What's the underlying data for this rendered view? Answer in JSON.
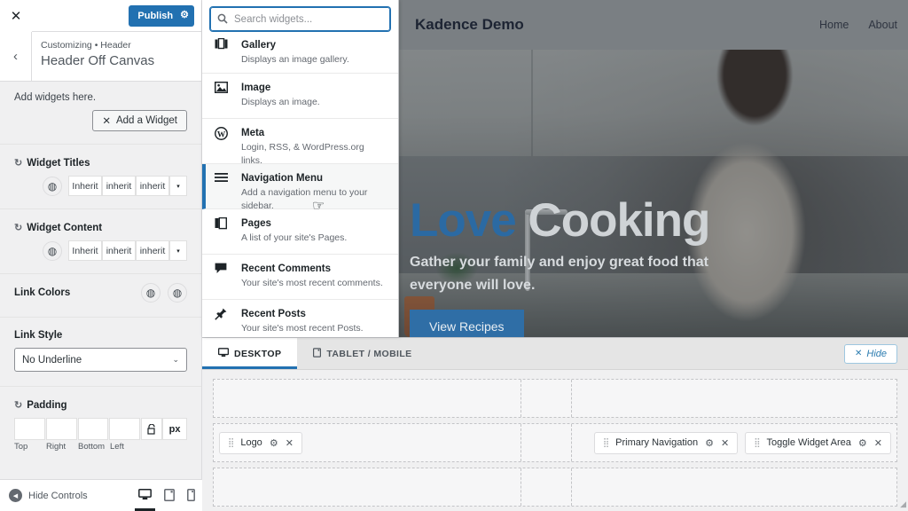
{
  "sidebar": {
    "close_icon": "✕",
    "publish_label": "Publish",
    "publish_gear_icon": "⚙",
    "back_icon": "‹",
    "breadcrumb": "Customizing • Header",
    "panel_title": "Header Off Canvas",
    "add_widgets_text": "Add widgets here.",
    "add_widget_label": "Add a Widget",
    "add_widget_icon": "✕",
    "controls": [
      {
        "label": "Widget Titles",
        "reset_icon": "↺",
        "globe_icon": "◍",
        "values": [
          "Inherit",
          "inherit",
          "inherit"
        ],
        "caret_icon": "▾"
      },
      {
        "label": "Widget Content",
        "reset_icon": "↺",
        "globe_icon": "◍",
        "values": [
          "Inherit",
          "inherit",
          "inherit"
        ],
        "caret_icon": "▾"
      }
    ],
    "link_colors": {
      "label": "Link Colors",
      "icons": [
        "◍",
        "◍"
      ]
    },
    "link_style": {
      "label": "Link Style",
      "value": "No Underline",
      "chevron_icon": "⌄"
    },
    "padding": {
      "label": "Padding",
      "reset_icon": "↺",
      "values": [
        "",
        "",
        "",
        ""
      ],
      "sub_labels": [
        "Top",
        "Right",
        "Bottom",
        "Left"
      ],
      "lock_icon": "⌂",
      "unit": "px"
    },
    "footer": {
      "hide_controls_label": "Hide Controls",
      "hide_controls_icon": "◀",
      "devices": [
        {
          "name": "desktop",
          "icon": "🖵",
          "active": true
        },
        {
          "name": "tablet",
          "icon": "▯",
          "active": false
        },
        {
          "name": "mobile",
          "icon": "▯",
          "active": false
        }
      ]
    }
  },
  "picker": {
    "search_placeholder": "Search widgets...",
    "search_value": "",
    "search_icon": "⌕",
    "widgets": [
      {
        "icon": "▣",
        "title": "Gallery",
        "desc": "Displays an image gallery.",
        "highlight": false
      },
      {
        "icon": "▨",
        "title": "Image",
        "desc": "Displays an image.",
        "highlight": false
      },
      {
        "icon": "Ⓦ",
        "title": "Meta",
        "desc": "Login, RSS, & WordPress.org links.",
        "highlight": false
      },
      {
        "icon": "☰",
        "title": "Navigation Menu",
        "desc": "Add a navigation menu to your sidebar.",
        "highlight": true
      },
      {
        "icon": "❑",
        "title": "Pages",
        "desc": "A list of your site's Pages.",
        "highlight": false
      },
      {
        "icon": "🗩",
        "title": "Recent Comments",
        "desc": "Your site's most recent comments.",
        "highlight": false
      },
      {
        "icon": "📌",
        "title": "Recent Posts",
        "desc": "Your site's most recent Posts.",
        "highlight": false
      }
    ]
  },
  "preview": {
    "brand": "Kadence Demo",
    "nav": [
      "Home",
      "About"
    ],
    "hero": {
      "title_blue": "Love",
      "title_white": " Cooking",
      "subtitle": "Gather your family and enjoy great food that everyone will love.",
      "button_label": "View Recipes"
    },
    "accent_blue": "#2b6aa3"
  },
  "bottom": {
    "tabs": [
      {
        "label": "DESKTOP",
        "icon": "🖵",
        "active": true
      },
      {
        "label": "TABLET / MOBILE",
        "icon": "▯",
        "active": false
      }
    ],
    "hide_label": "Hide",
    "hide_icon": "✕",
    "rows": [
      {
        "left": [],
        "right": []
      },
      {
        "left": [
          {
            "label": "Logo",
            "grip": "⣿",
            "gear": "⚙",
            "close": "✕"
          }
        ],
        "right": [
          {
            "label": "Primary Navigation",
            "grip": "⣿",
            "gear": "⚙",
            "close": "✕"
          },
          {
            "label": "Toggle Widget Area",
            "grip": "⣿",
            "gear": "⚙",
            "close": "✕"
          }
        ]
      },
      {
        "left": [],
        "right": []
      }
    ]
  },
  "cursor_icon": "☞"
}
